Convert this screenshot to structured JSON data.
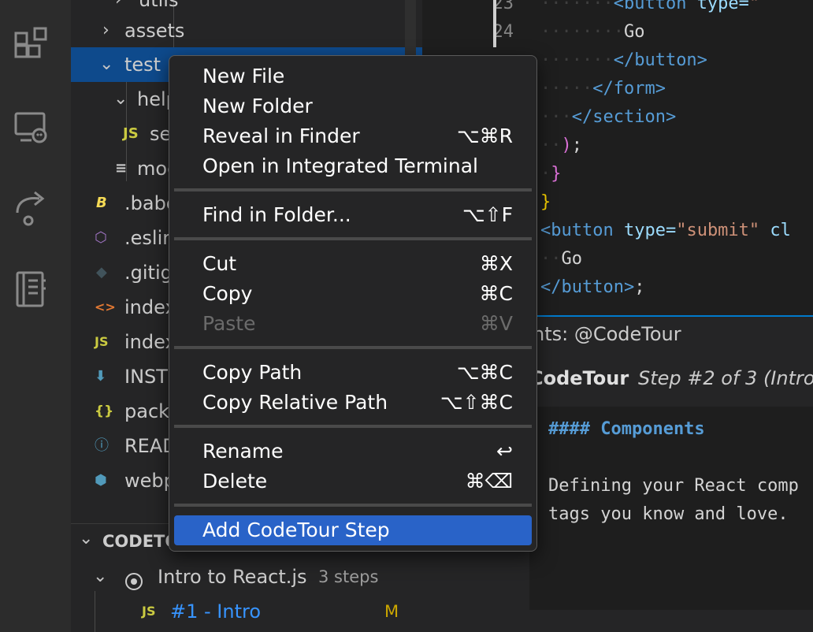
{
  "explorer": {
    "rows": [
      {
        "label": "utils",
        "type": "folder-closed"
      },
      {
        "label": "assets",
        "type": "folder-closed"
      },
      {
        "label": "test",
        "type": "folder-open"
      },
      {
        "label": "help",
        "type": "folder-open"
      },
      {
        "label": "se",
        "icon_text": "JS"
      },
      {
        "label": "moc",
        "icon_text": "≡"
      },
      {
        "label": ".babe",
        "icon_text": "B"
      },
      {
        "label": ".eslir",
        "icon_text": "⬡"
      },
      {
        "label": ".gitig",
        "icon_text": "◆"
      },
      {
        "label": "index",
        "icon_text": "<>"
      },
      {
        "label": "index",
        "icon_text": "JS"
      },
      {
        "label": "INST",
        "icon_text": "⬇"
      },
      {
        "label": "pack",
        "icon_text": "{}"
      },
      {
        "label": "READ",
        "icon_text": "ⓘ"
      },
      {
        "label": "webp",
        "icon_text": "⬢"
      }
    ]
  },
  "codetour": {
    "section_title": "CODETO",
    "tour_title": "Intro to React.js",
    "tour_steps": "3 steps",
    "step_js_icon": "JS",
    "step_label": "#1 - Intro",
    "step_status": "M"
  },
  "editor": {
    "line_numbers": [
      "23",
      "24"
    ],
    "lines": [
      {
        "ind": "·······",
        "parts": [
          [
            "tag",
            "<button "
          ],
          [
            "attr",
            "type="
          ],
          [
            "str",
            "\""
          ]
        ]
      },
      {
        "ind": "········",
        "parts": [
          [
            "white",
            "Go"
          ]
        ]
      },
      {
        "ind": "·······",
        "parts": [
          [
            "tag",
            "</button>"
          ]
        ]
      },
      {
        "ind": "·····",
        "parts": [
          [
            "tag",
            "</form>"
          ]
        ]
      },
      {
        "ind": "···",
        "parts": [
          [
            "tag",
            "</section>"
          ]
        ]
      },
      {
        "ind": "··",
        "parts": [
          [
            "pink",
            ")"
          ],
          [
            "white",
            ";"
          ]
        ]
      },
      {
        "ind": "·",
        "parts": [
          [
            "pink",
            "}"
          ]
        ]
      },
      {
        "ind": "",
        "parts": [
          [
            "yel",
            "}"
          ]
        ]
      },
      {
        "ind": "",
        "parts": [
          [
            "tag",
            "<button "
          ],
          [
            "attr",
            "type="
          ],
          [
            "str",
            "\"submit\""
          ],
          [
            "attr",
            " cl"
          ]
        ]
      },
      {
        "ind": "··",
        "parts": [
          [
            "white",
            "Go"
          ]
        ]
      },
      {
        "ind": "",
        "parts": [
          [
            "tag",
            "</button>"
          ],
          [
            "white",
            ";"
          ]
        ]
      }
    ]
  },
  "comments": {
    "header": "nts: @CodeTour",
    "author": "CodeTour",
    "step_text": "Step #2 of 3 (Intro",
    "md_heading": "#### Components",
    "md_line1": "Defining your React comp",
    "md_line2": "tags you know and love."
  },
  "context_menu": {
    "groups": [
      [
        {
          "label": "New File",
          "shortcut": ""
        },
        {
          "label": "New Folder",
          "shortcut": ""
        },
        {
          "label": "Reveal in Finder",
          "shortcut": "⌥⌘R"
        },
        {
          "label": "Open in Integrated Terminal",
          "shortcut": ""
        }
      ],
      [
        {
          "label": "Find in Folder...",
          "shortcut": "⌥⇧F"
        }
      ],
      [
        {
          "label": "Cut",
          "shortcut": "⌘X"
        },
        {
          "label": "Copy",
          "shortcut": "⌘C"
        },
        {
          "label": "Paste",
          "shortcut": "⌘V",
          "disabled": true
        }
      ],
      [
        {
          "label": "Copy Path",
          "shortcut": "⌥⌘C"
        },
        {
          "label": "Copy Relative Path",
          "shortcut": "⌥⇧⌘C"
        }
      ],
      [
        {
          "label": "Rename",
          "shortcut": "↩"
        },
        {
          "label": "Delete",
          "shortcut": "⌘⌫"
        }
      ],
      [
        {
          "label": "Add CodeTour Step",
          "shortcut": "",
          "active": true
        }
      ]
    ]
  },
  "colors": {
    "selection": "#0e4a8c",
    "menu_highlight": "#2963c8",
    "js_yellow": "#cbcb41",
    "link_blue": "#3794ff"
  }
}
